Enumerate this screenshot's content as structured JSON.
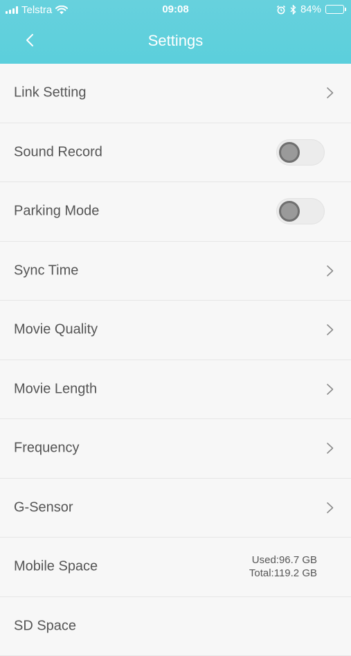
{
  "statusbar": {
    "carrier": "Telstra",
    "time": "09:08",
    "battery": "84%",
    "battery_level": 0.84
  },
  "nav": {
    "title": "Settings"
  },
  "settings": [
    {
      "label": "Link Setting",
      "control": "chevron"
    },
    {
      "label": "Sound Record",
      "control": "toggle",
      "on": false
    },
    {
      "label": "Parking Mode",
      "control": "toggle",
      "on": false
    },
    {
      "label": "Sync Time",
      "control": "chevron"
    },
    {
      "label": "Movie Quality",
      "control": "chevron"
    },
    {
      "label": "Movie Length",
      "control": "chevron"
    },
    {
      "label": "Frequency",
      "control": "chevron"
    },
    {
      "label": "G-Sensor",
      "control": "chevron"
    },
    {
      "label": "Mobile Space",
      "control": "info",
      "used": "Used:96.7 GB",
      "total": "Total:119.2 GB"
    },
    {
      "label": "SD Space",
      "control": "info"
    }
  ],
  "colors": {
    "accent": "#5bcfdc",
    "background": "#f7f7f7",
    "text": "#555555"
  },
  "icons": {
    "back": "chevron-left-icon",
    "row": "chevron-right-icon"
  }
}
